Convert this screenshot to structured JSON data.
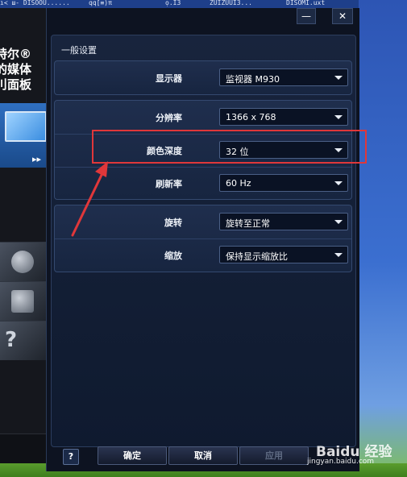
{
  "desktop": {
    "top_strip_texts": [
      "ı≺ ш- DISOOU......",
      "qq[≡)π",
      "ọ.IЗ",
      "ZUIZUUIЗ...",
      "DISOMI.uxt"
    ]
  },
  "left_panel": {
    "brand_lines": [
      "特尔®",
      "的媒体",
      "刂面板"
    ],
    "banner_arrow": "▸▸",
    "help_tile_glyph": "?"
  },
  "window": {
    "minimize_label": "—",
    "close_label": "✕"
  },
  "settings": {
    "section_title": "一般设置",
    "display": {
      "label": "显示器",
      "value": "监视器 M930"
    },
    "resolution": {
      "label": "分辨率",
      "value": "1366 x 768"
    },
    "color_depth": {
      "label": "颜色深度",
      "value": "32 位"
    },
    "refresh_rate": {
      "label": "刷新率",
      "value": "60 Hz"
    },
    "rotation": {
      "label": "旋转",
      "value": "旋转至正常"
    },
    "scaling": {
      "label": "缩放",
      "value": "保持显示缩放比"
    }
  },
  "footer": {
    "help_label": "?",
    "ok_label": "确定",
    "cancel_label": "取消",
    "apply_label": "应用"
  },
  "watermark": {
    "main": "Baidu 经验",
    "sub": "jingyan.baidu.com"
  },
  "colors": {
    "annotation_red": "#e0373a",
    "panel_bg": "#18243d",
    "select_bg": "#0a1224"
  }
}
